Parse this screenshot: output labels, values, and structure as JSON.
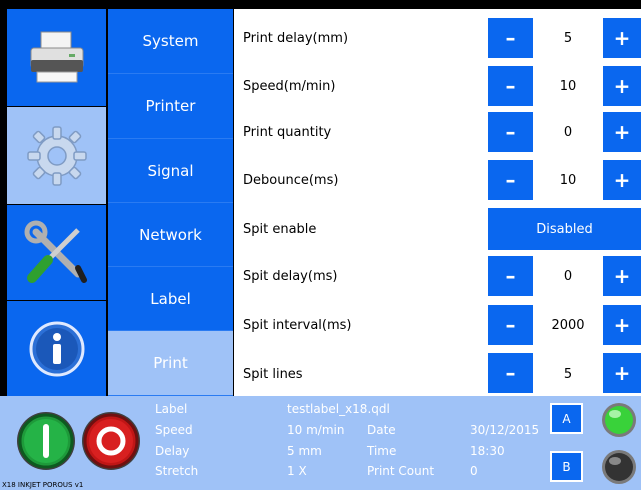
{
  "menu": {
    "items": [
      {
        "label": "System"
      },
      {
        "label": "Printer"
      },
      {
        "label": "Signal"
      },
      {
        "label": "Network"
      },
      {
        "label": "Label"
      },
      {
        "label": "Print"
      }
    ],
    "active": "Print"
  },
  "params": {
    "rows": [
      {
        "label": "Print delay(mm)",
        "value": "5"
      },
      {
        "label": "Speed(m/min)",
        "value": "10"
      },
      {
        "label": "Print quantity",
        "value": "0"
      },
      {
        "label": "Debounce(ms)",
        "value": "10"
      },
      {
        "label": "Spit enable",
        "value": "Disabled"
      },
      {
        "label": "Spit delay(ms)",
        "value": "0"
      },
      {
        "label": "Spit interval(ms)",
        "value": "2000"
      },
      {
        "label": "Spit lines",
        "value": "5"
      }
    ],
    "minus_symbol": "–",
    "plus_symbol": "+"
  },
  "status": {
    "label_key": "Label",
    "label_val": "testlabel_x18.qdl",
    "speed_key": "Speed",
    "speed_val": "10 m/min",
    "delay_key": "Delay",
    "delay_val": "5 mm",
    "stretch_key": "Stretch",
    "stretch_val": "1 X",
    "date_key": "Date",
    "date_val": "30/12/2015",
    "time_key": "Time",
    "time_val": "18:30",
    "count_key": "Print Count",
    "count_val": "0",
    "btn_a": "A",
    "btn_b": "B",
    "footer": "X18 INKJET POROUS v1"
  },
  "colors": {
    "blue": "#0a67ef",
    "light_blue": "#9fc2f7",
    "start_green": "#1e9a3a",
    "stop_red": "#d01818",
    "lamp_green": "#39d23a",
    "lamp_dark": "#333333"
  }
}
